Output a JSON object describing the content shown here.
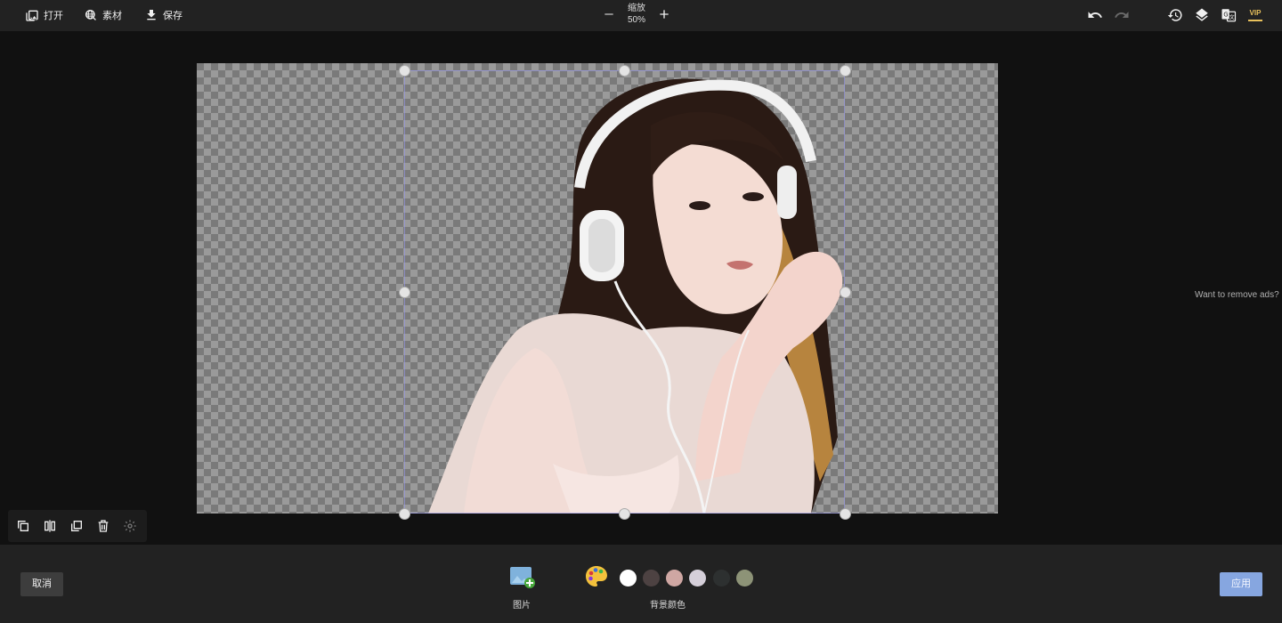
{
  "toolbar": {
    "open_label": "打开",
    "material_label": "素材",
    "save_label": "保存",
    "zoom_title": "缩放",
    "zoom_value": "50%",
    "vip_label": "VIP"
  },
  "sidebar_ad": {
    "text": "Want to remove ads?"
  },
  "bottom": {
    "cancel_label": "取消",
    "apply_label": "应用",
    "image_label": "图片",
    "bg_color_label": "背景颜色",
    "swatches": [
      "#ffffff",
      "#4d4242",
      "#cfa7a3",
      "#d5cfd9",
      "#2d3030",
      "#8d9377"
    ]
  },
  "colors": {
    "accent": "#86a6e0",
    "vip": "#e8c15c"
  }
}
